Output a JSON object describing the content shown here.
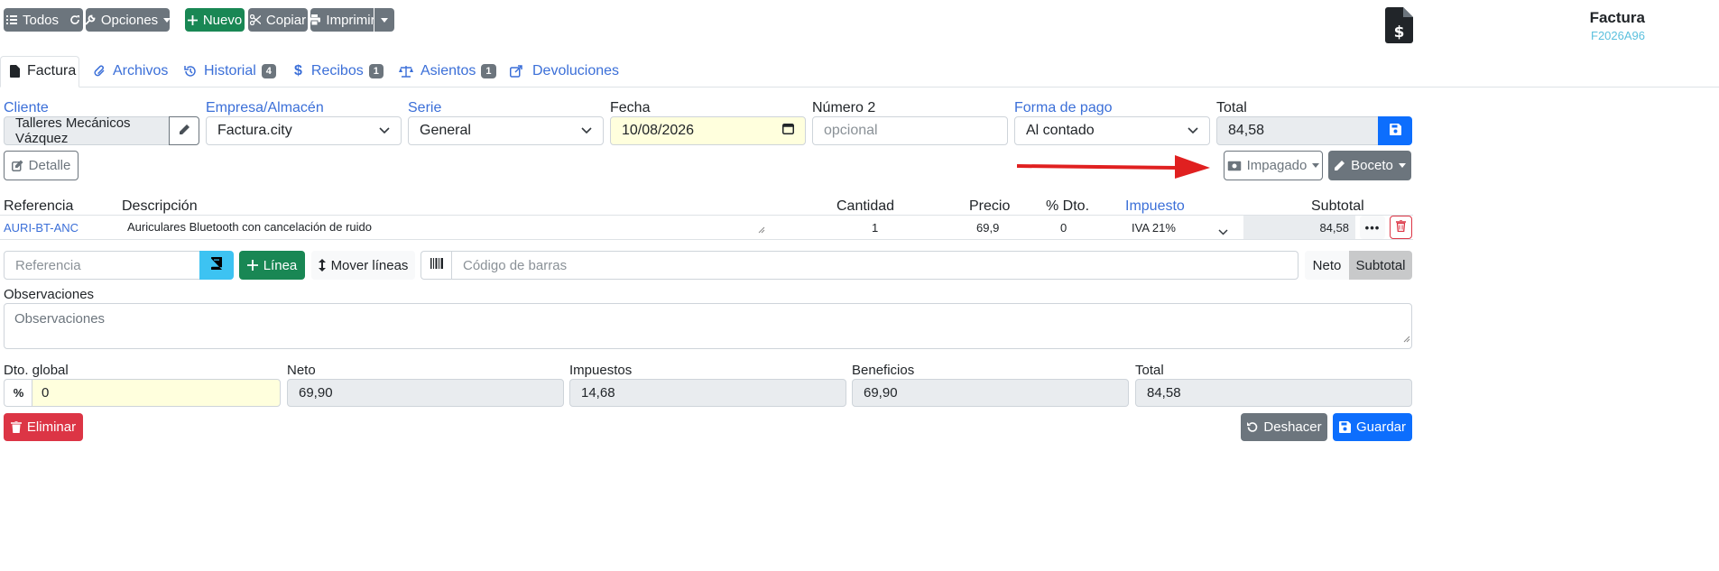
{
  "toolbar": {
    "all_label": "Todos",
    "options_label": "Opciones",
    "new_label": "Nuevo",
    "copy_label": "Copiar",
    "print_label": "Imprimir"
  },
  "doc": {
    "title": "Factura",
    "code": "F2026A96"
  },
  "tabs": [
    {
      "label": "Factura"
    },
    {
      "label": "Archivos"
    },
    {
      "label": "Historial",
      "badge": "4"
    },
    {
      "label": "Recibos",
      "badge": "1"
    },
    {
      "label": "Asientos",
      "badge": "1"
    },
    {
      "label": "Devoluciones"
    }
  ],
  "form": {
    "client_label": "Cliente",
    "client_value": "Talleres Mecánicos Vázquez",
    "company_label": "Empresa/Almacén",
    "company_value": "Factura.city",
    "series_label": "Serie",
    "series_value": "General",
    "date_label": "Fecha",
    "date_value": "10/08/2026",
    "number2_label": "Número 2",
    "number2_placeholder": "opcional",
    "payment_label": "Forma de pago",
    "payment_value": "Al contado",
    "total_label": "Total",
    "total_value": "84,58",
    "detail_label": "Detalle",
    "unpaid_label": "Impagado",
    "draft_label": "Boceto"
  },
  "lines": {
    "headers": {
      "reference": "Referencia",
      "description": "Descripción",
      "quantity": "Cantidad",
      "price": "Precio",
      "discount": "% Dto.",
      "tax": "Impuesto",
      "subtotal": "Subtotal"
    },
    "rows": [
      {
        "reference": "AURI-BT-ANC",
        "description": "Auriculares Bluetooth con cancelación de ruido",
        "quantity": "1",
        "price": "69,9",
        "discount": "0",
        "tax": "IVA 21%",
        "subtotal": "84,58"
      }
    ]
  },
  "add_line": {
    "reference_placeholder": "Referencia",
    "line_label": "Línea",
    "move_label": "Mover líneas",
    "barcode_placeholder": "Código de barras",
    "net_label": "Neto",
    "subtotal_label": "Subtotal"
  },
  "notes": {
    "label": "Observaciones",
    "placeholder": "Observaciones"
  },
  "totals": {
    "discount_label": "Dto. global",
    "discount_value": "0",
    "net_label": "Neto",
    "net_value": "69,90",
    "taxes_label": "Impuestos",
    "taxes_value": "14,68",
    "profit_label": "Beneficios",
    "profit_value": "69,90",
    "total_label": "Total",
    "total_value": "84,58"
  },
  "footer": {
    "delete_label": "Eliminar",
    "undo_label": "Deshacer",
    "save_label": "Guardar"
  },
  "colors": {
    "link": "#3b6fd8",
    "success": "#198754",
    "danger": "#dc3545",
    "primary": "#0d6efd",
    "secondary": "#6c757d",
    "annotation_arrow": "#e02020"
  }
}
